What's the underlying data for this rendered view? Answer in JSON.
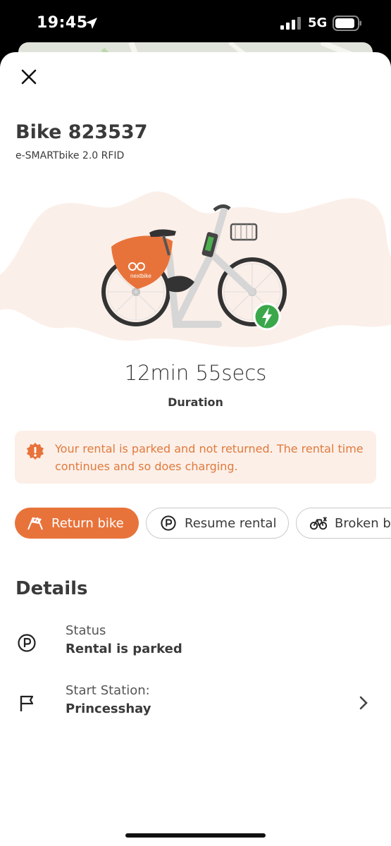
{
  "status_bar": {
    "time": "19:45",
    "network": "5G",
    "icons": [
      "location-arrow-icon",
      "signal-bars-icon",
      "battery-icon"
    ]
  },
  "header": {
    "close_icon": "close-icon",
    "title": "Bike 823537",
    "subtitle": "e-SMARTbike 2.0 RFID"
  },
  "hero": {
    "bike_brand_text": "nextbike",
    "charging_badge_icon": "lightning-icon",
    "colors": {
      "accent": "#e8733a",
      "charge": "#3aa84a",
      "blob": "#fbefe9"
    }
  },
  "rental": {
    "duration_value": "12min 55secs",
    "duration_label": "Duration"
  },
  "alert": {
    "icon": "warning-badge-icon",
    "text": "Your rental is parked and not returned. The rental time continues and so does charging."
  },
  "actions": [
    {
      "label": "Return bike",
      "icon": "checkered-flags-icon",
      "primary": true
    },
    {
      "label": "Resume rental",
      "icon": "parking-icon",
      "primary": false
    },
    {
      "label": "Broken b",
      "icon": "broken-bike-icon",
      "primary": false
    }
  ],
  "details": {
    "title": "Details",
    "rows": [
      {
        "icon": "parking-icon",
        "label": "Status",
        "value": "Rental is parked"
      },
      {
        "icon": "flag-icon",
        "label": "Start Station:",
        "value": "Princesshay",
        "chevron": true
      }
    ]
  },
  "colors": {
    "accent": "#e8733a",
    "alert_bg": "#fcefe8",
    "alert_text": "#e07a3c",
    "text": "#3a3a3a"
  }
}
